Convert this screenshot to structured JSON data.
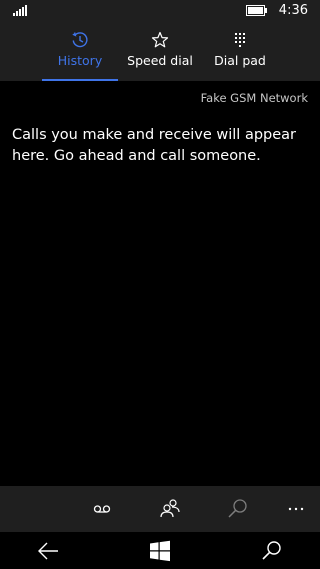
{
  "status_bar": {
    "time": "4:36",
    "signal_icon": "signal-bars-icon",
    "battery_icon": "battery-icon"
  },
  "tabs": [
    {
      "label": "History",
      "icon": "history-icon",
      "active": true
    },
    {
      "label": "Speed dial",
      "icon": "star-icon",
      "active": false
    },
    {
      "label": "Dial pad",
      "icon": "dialpad-icon",
      "active": false
    }
  ],
  "network": "Fake GSM Network",
  "empty_message": "Calls you make and receive will appear here. Go ahead and call someone.",
  "app_bar": {
    "buttons": [
      {
        "icon": "voicemail-icon"
      },
      {
        "icon": "contacts-icon"
      },
      {
        "icon": "search-icon"
      },
      {
        "icon": "more-icon"
      }
    ]
  },
  "nav_bar": {
    "buttons": [
      {
        "icon": "back-icon"
      },
      {
        "icon": "windows-start-icon"
      },
      {
        "icon": "search-icon"
      }
    ]
  },
  "colors": {
    "accent": "#3f74e8",
    "background": "#000000",
    "chrome": "#1f1f1f",
    "text": "#ffffff",
    "secondary_text": "#c6c6c6"
  }
}
